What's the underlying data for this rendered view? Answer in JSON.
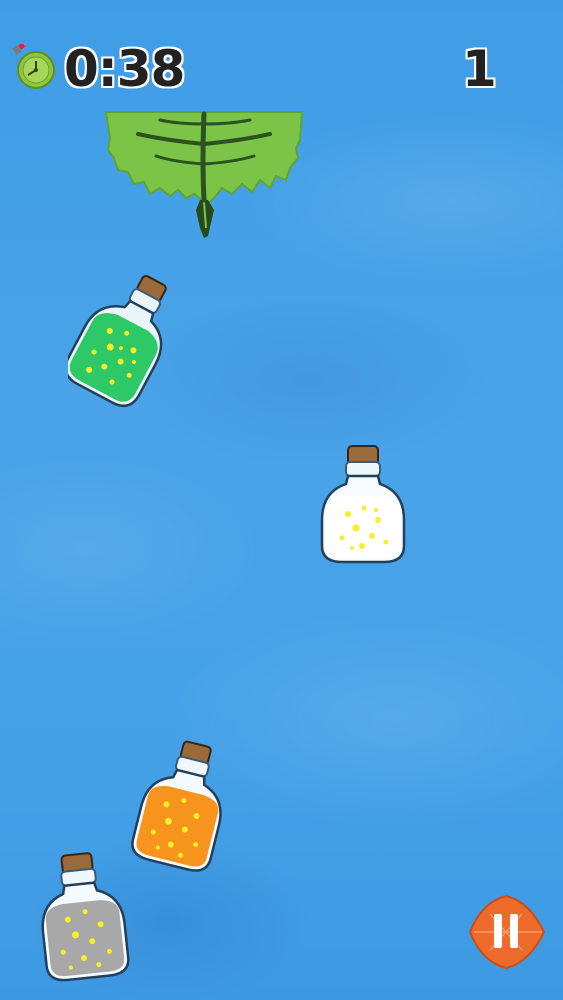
{
  "hud": {
    "timer": "0:38",
    "score": "1",
    "timer_icon": "stopwatch-icon"
  },
  "board": {
    "leaf_target": "leaf-platform",
    "bottles": [
      {
        "name": "green-bottle",
        "liquid": "#2ec866",
        "liquid_dark": "#1e9e4c"
      },
      {
        "name": "white-bottle",
        "liquid": "#ffffff",
        "liquid_dark": "#dde7ee"
      },
      {
        "name": "orange-bottle",
        "liquid": "#f7941d",
        "liquid_dark": "#e07a10"
      },
      {
        "name": "gray-bottle",
        "liquid": "#a8a8a8",
        "liquid_dark": "#8c8c8c"
      }
    ]
  },
  "controls": {
    "pause_icon": "pause-icon",
    "pause_color": "#ee6a2a"
  },
  "colors": {
    "sky": "#46a2e8",
    "leaf": "#7cc447",
    "sparkle": "#f6ef2a",
    "cork": "#9a6a3a"
  }
}
